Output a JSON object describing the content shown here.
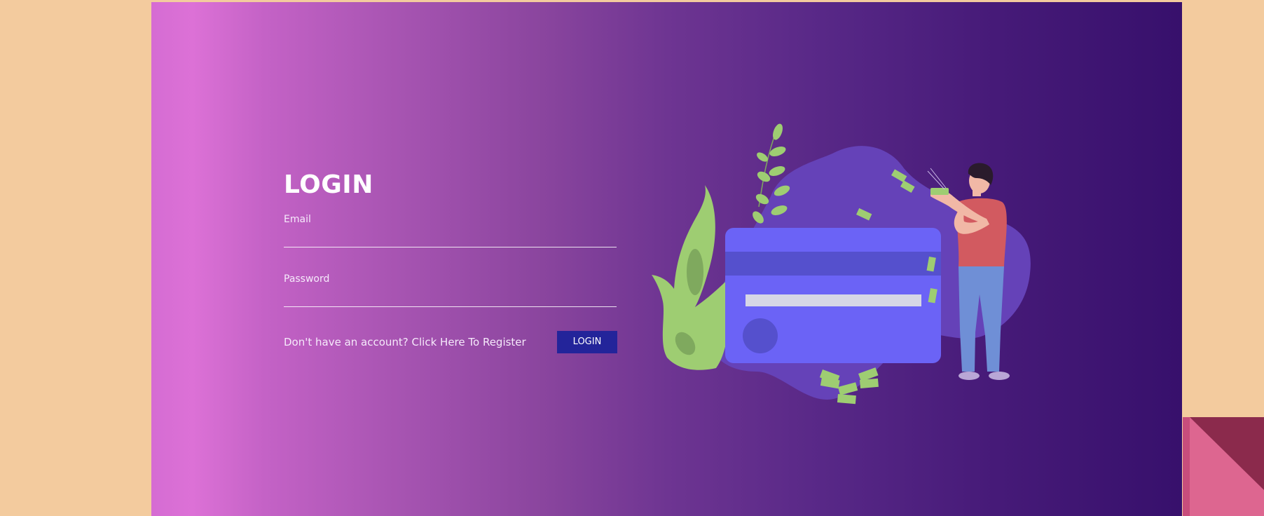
{
  "login_form": {
    "title": "LOGIN",
    "email": {
      "label": "Email",
      "value": "",
      "placeholder": ""
    },
    "password": {
      "label": "Password",
      "value": "",
      "placeholder": ""
    },
    "register_text": "Don't have an account? Click Here To Register",
    "submit_label": "LOGIN"
  },
  "colors": {
    "background": "#f3cb9e",
    "gradient_start": "#dc71d6",
    "gradient_end": "#37106c",
    "login_button": "#23249a",
    "card": "#6b63f6",
    "blob": "#6542b8",
    "leaf": "#9ecd72",
    "shirt": "#d25a60",
    "pants": "#6f8fd6",
    "corner_pink": "#dd6690",
    "corner_dark": "#8b2a4c"
  },
  "icons": {
    "illustration": "credit-card-money-illustration",
    "corner": "corner-triangle-decoration"
  }
}
